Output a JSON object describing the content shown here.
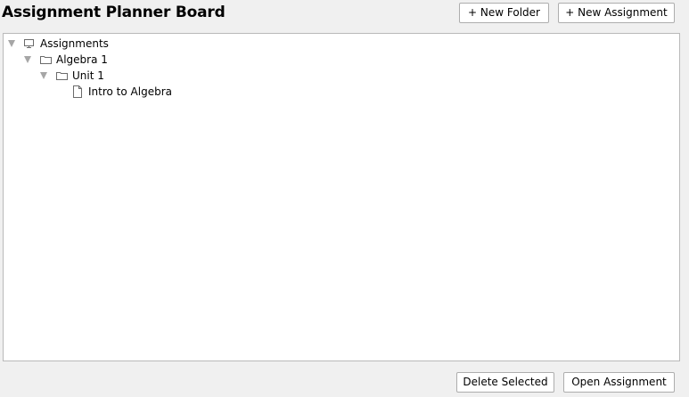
{
  "header": {
    "title": "Assignment Planner Board",
    "new_folder_label": "+ New Folder",
    "new_assignment_label": "+ New Assignment"
  },
  "tree": {
    "root": {
      "label": "Assignments",
      "icon": "computer-icon",
      "expanded": true
    },
    "folder": {
      "label": "Algebra 1",
      "icon": "folder-icon",
      "expanded": true
    },
    "subfolder": {
      "label": "Unit 1",
      "icon": "folder-icon",
      "expanded": true
    },
    "file": {
      "label": "Intro to Algebra",
      "icon": "document-icon"
    }
  },
  "footer": {
    "delete_label": "Delete Selected",
    "open_label": "Open Assignment"
  }
}
